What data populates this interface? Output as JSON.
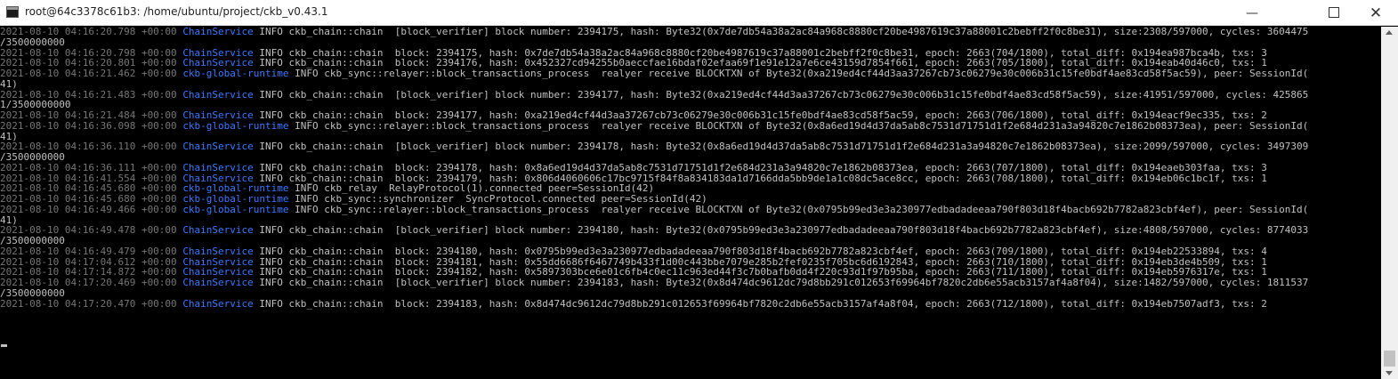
{
  "window": {
    "title": "root@64c3378c61b3: /home/ubuntu/project/ckb_v0.43.1",
    "minimize_glyph": "—",
    "close_glyph": "✕",
    "icons": [
      "terminal-icon",
      "minimize-icon",
      "maximize-icon",
      "close-icon",
      "scroll-up-arrow-icon",
      "scroll-down-arrow-icon"
    ]
  },
  "colors": {
    "timestamp": "#767676",
    "tag": "#3b78ff",
    "text": "#c0c0c0",
    "background": "#000000"
  },
  "console": {
    "lines": [
      {
        "ts": "2021-08-10 04:16:20.798 +00:00",
        "tag": "ChainService",
        "msg": " INFO ckb_chain::chain  [block_verifier] block number: 2394175, hash: Byte32(0x7de7db54a38a2ac84a968c8880cf20be4987619c37a88001c2bebff2f0c8be31), size:2308/597000, cycles: 3604475"
      },
      {
        "ts": "",
        "tag": "",
        "msg": "/3500000000"
      },
      {
        "ts": "2021-08-10 04:16:20.798 +00:00",
        "tag": "ChainService",
        "msg": " INFO ckb_chain::chain  block: 2394175, hash: 0x7de7db54a38a2ac84a968c8880cf20be4987619c37a88001c2bebff2f0c8be31, epoch: 2663(704/1800), total_diff: 0x194ea987bca4b, txs: 3"
      },
      {
        "ts": "2021-08-10 04:16:20.801 +00:00",
        "tag": "ChainService",
        "msg": " INFO ckb_chain::chain  block: 2394176, hash: 0x452327cd94255b0aeccfae16bdaf02efaa69f1e91e12a7e6ce43159d7854f661, epoch: 2663(705/1800), total_diff: 0x194eab40d46c0, txs: 1"
      },
      {
        "ts": "2021-08-10 04:16:21.462 +00:00",
        "tag": "ckb-global-runtime",
        "msg": " INFO ckb_sync::relayer::block_transactions_process  realyer receive BLOCKTXN of Byte32(0xa219ed4cf44d3aa37267cb73c06279e30c006b31c15fe0bdf4ae83cd58f5ac59), peer: SessionId("
      },
      {
        "ts": "",
        "tag": "",
        "msg": "41)"
      },
      {
        "ts": "2021-08-10 04:16:21.483 +00:00",
        "tag": "ChainService",
        "msg": " INFO ckb_chain::chain  [block_verifier] block number: 2394177, hash: Byte32(0xa219ed4cf44d3aa37267cb73c06279e30c006b31c15fe0bdf4ae83cd58f5ac59), size:41951/597000, cycles: 425865"
      },
      {
        "ts": "",
        "tag": "",
        "msg": "1/3500000000"
      },
      {
        "ts": "2021-08-10 04:16:21.484 +00:00",
        "tag": "ChainService",
        "msg": " INFO ckb_chain::chain  block: 2394177, hash: 0xa219ed4cf44d3aa37267cb73c06279e30c006b31c15fe0bdf4ae83cd58f5ac59, epoch: 2663(706/1800), total_diff: 0x194eacf9ec335, txs: 2"
      },
      {
        "ts": "2021-08-10 04:16:36.098 +00:00",
        "tag": "ckb-global-runtime",
        "msg": " INFO ckb_sync::relayer::block_transactions_process  realyer receive BLOCKTXN of Byte32(0x8a6ed19d4d37da5ab8c7531d71751d1f2e684d231a3a94820c7e1862b08373ea), peer: SessionId("
      },
      {
        "ts": "",
        "tag": "",
        "msg": "41)"
      },
      {
        "ts": "2021-08-10 04:16:36.110 +00:00",
        "tag": "ChainService",
        "msg": " INFO ckb_chain::chain  [block_verifier] block number: 2394178, hash: Byte32(0x8a6ed19d4d37da5ab8c7531d71751d1f2e684d231a3a94820c7e1862b08373ea), size:2099/597000, cycles: 3497309"
      },
      {
        "ts": "",
        "tag": "",
        "msg": "/3500000000"
      },
      {
        "ts": "2021-08-10 04:16:36.111 +00:00",
        "tag": "ChainService",
        "msg": " INFO ckb_chain::chain  block: 2394178, hash: 0x8a6ed19d4d37da5ab8c7531d71751d1f2e684d231a3a94820c7e1862b08373ea, epoch: 2663(707/1800), total_diff: 0x194eaeb303faa, txs: 3"
      },
      {
        "ts": "2021-08-10 04:16:41.554 +00:00",
        "tag": "ChainService",
        "msg": " INFO ckb_chain::chain  block: 2394179, hash: 0x806d4060606c17bc9715f84f8a834183da1d7166dda5bb9de1a1c08dc5ace8cc, epoch: 2663(708/1800), total_diff: 0x194eb06c1bc1f, txs: 1"
      },
      {
        "ts": "2021-08-10 04:16:45.680 +00:00",
        "tag": "ckb-global-runtime",
        "msg": " INFO ckb_relay  RelayProtocol(1).connected peer=SessionId(42)"
      },
      {
        "ts": "2021-08-10 04:16:45.680 +00:00",
        "tag": "ckb-global-runtime",
        "msg": " INFO ckb_sync::synchronizer  SyncProtocol.connected peer=SessionId(42)"
      },
      {
        "ts": "2021-08-10 04:16:49.466 +00:00",
        "tag": "ckb-global-runtime",
        "msg": " INFO ckb_sync::relayer::block_transactions_process  realyer receive BLOCKTXN of Byte32(0x0795b99ed3e3a230977edbadadeeaa790f803d18f4bacb692b7782a823cbf4ef), peer: SessionId("
      },
      {
        "ts": "",
        "tag": "",
        "msg": "41)"
      },
      {
        "ts": "2021-08-10 04:16:49.478 +00:00",
        "tag": "ChainService",
        "msg": " INFO ckb_chain::chain  [block_verifier] block number: 2394180, hash: Byte32(0x0795b99ed3e3a230977edbadadeeaa790f803d18f4bacb692b7782a823cbf4ef), size:4808/597000, cycles: 8774033"
      },
      {
        "ts": "",
        "tag": "",
        "msg": "/3500000000"
      },
      {
        "ts": "2021-08-10 04:16:49.479 +00:00",
        "tag": "ChainService",
        "msg": " INFO ckb_chain::chain  block: 2394180, hash: 0x0795b99ed3e3a230977edbadadeeaa790f803d18f4bacb692b7782a823cbf4ef, epoch: 2663(709/1800), total_diff: 0x194eb22533894, txs: 4"
      },
      {
        "ts": "2021-08-10 04:17:04.612 +00:00",
        "tag": "ChainService",
        "msg": " INFO ckb_chain::chain  block: 2394181, hash: 0x55dd6686f6467749b433f1d00c443bbe7079e285b2fef0235f705bc6d6192843, epoch: 2663(710/1800), total_diff: 0x194eb3de4b509, txs: 1"
      },
      {
        "ts": "2021-08-10 04:17:14.872 +00:00",
        "tag": "ChainService",
        "msg": " INFO ckb_chain::chain  block: 2394182, hash: 0x5897303bce6e01c6fb4c0ec11c963ed44f3c7b0bafb0dd4f220c93d1f97b95ba, epoch: 2663(711/1800), total_diff: 0x194eb5976317e, txs: 1"
      },
      {
        "ts": "2021-08-10 04:17:20.469 +00:00",
        "tag": "ChainService",
        "msg": " INFO ckb_chain::chain  [block_verifier] block number: 2394183, hash: Byte32(0x8d474dc9612dc79d8bb291c012653f69964bf7820c2db6e55acb3157af4a8f04), size:1482/597000, cycles: 1811537"
      },
      {
        "ts": "",
        "tag": "",
        "msg": "/3500000000"
      },
      {
        "ts": "2021-08-10 04:17:20.470 +00:00",
        "tag": "ChainService",
        "msg": " INFO ckb_chain::chain  block: 2394183, hash: 0x8d474dc9612dc79d8bb291c012653f69964bf7820c2db6e55acb3157af4a8f04, epoch: 2663(712/1800), total_diff: 0x194eb7507adf3, txs: 2"
      }
    ]
  }
}
